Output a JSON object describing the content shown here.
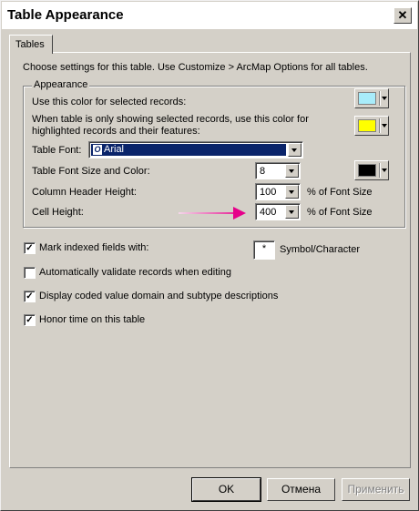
{
  "window": {
    "title": "Table Appearance",
    "close_glyph": "✕"
  },
  "tabs": [
    {
      "label": "Tables"
    }
  ],
  "intro_text": "Choose settings for this table. Use Customize > ArcMap Options for all tables.",
  "appearance": {
    "group_title": "Appearance",
    "selected_color_label": "Use this color for selected records:",
    "selected_color": "#a8ecfa",
    "highlight_color_label_line1": "When table is only showing selected records, use this color for",
    "highlight_color_label_line2": "highlighted records and their features:",
    "highlight_color": "#ffff00",
    "font_label": "Table Font:",
    "font_value": "Arial",
    "font_icon": "O",
    "font_size_label": "Table Font Size and Color:",
    "font_size_value": "8",
    "font_color": "#000000",
    "header_height_label": "Column Header Height:",
    "header_height_value": "100",
    "header_height_unit": "% of Font Size",
    "cell_height_label": "Cell Height:",
    "cell_height_value": "400",
    "cell_height_unit": "% of Font Size"
  },
  "options": {
    "mark_indexed": {
      "label": "Mark indexed fields with:",
      "checked": true,
      "symbol": "*",
      "symbol_label": "Symbol/Character"
    },
    "auto_validate": {
      "label": "Automatically validate records when editing",
      "checked": false
    },
    "coded_values": {
      "label": "Display coded value domain and subtype descriptions",
      "checked": true
    },
    "honor_time": {
      "label": "Honor time on this table",
      "checked": true
    }
  },
  "buttons": {
    "ok": "OK",
    "cancel": "Отмена",
    "apply": "Применить"
  },
  "annotation_color": "#e6008a"
}
